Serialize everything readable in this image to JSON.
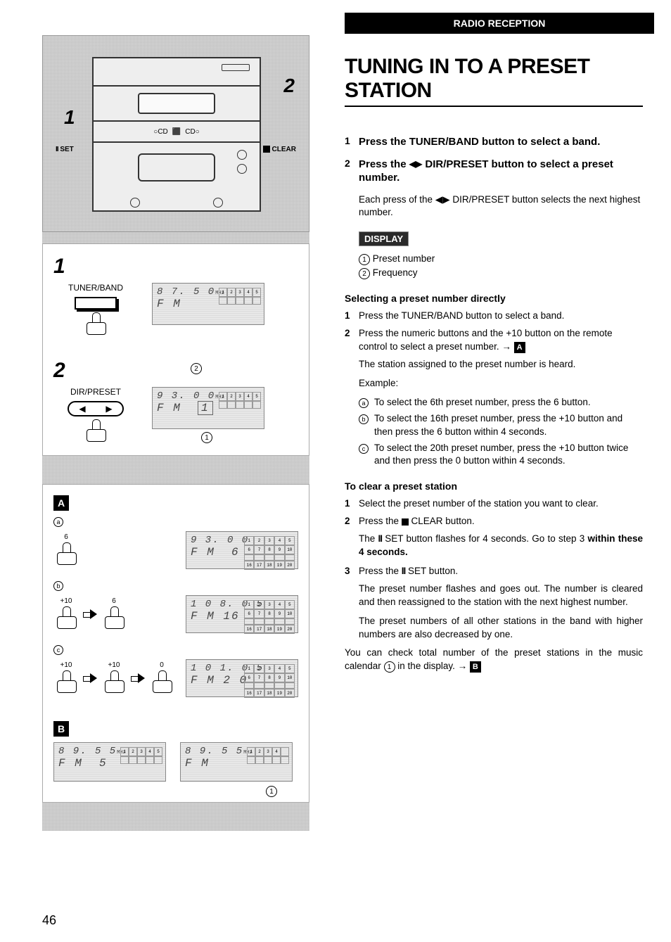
{
  "header": "RADIO RECEPTION",
  "title": "TUNING IN TO A PRESET STATION",
  "page_number": "46",
  "device": {
    "callout1": "1",
    "callout2": "2",
    "set_label": "SET",
    "clear_label": "CLEAR"
  },
  "panel1": {
    "step": "1",
    "button_label": "TUNER/BAND",
    "lcd_freq": "8 7. 5 0",
    "lcd_mhz": "MHz",
    "lcd_band": "F M"
  },
  "panel2": {
    "step": "2",
    "button_label": "DIR/PRESET",
    "callout_top": "2",
    "callout_bottom": "1",
    "lcd_freq": "9 3. 0 0",
    "lcd_mhz": "MHz",
    "lcd_band": "F M",
    "lcd_preset": "1"
  },
  "panelA": {
    "letter": "A",
    "rows": {
      "a": {
        "tag": "a",
        "presses": [
          "6"
        ],
        "freq": "9 3. 0 0",
        "band": "F M",
        "preset": "6"
      },
      "b": {
        "tag": "b",
        "presses": [
          "+10",
          "6"
        ],
        "freq": "1 0 8. 0 5",
        "band": "F M",
        "preset": "16"
      },
      "c": {
        "tag": "c",
        "presses": [
          "+10",
          "+10",
          "0"
        ],
        "freq": "1 0 1. 0 5",
        "band": "F M 2 0"
      }
    }
  },
  "panelB": {
    "letter": "B",
    "callout": "1",
    "left": {
      "freq": "8 9. 5 5",
      "mhz": "MHz",
      "band": "F M",
      "preset": "5",
      "grid_n": "5"
    },
    "right": {
      "freq": "8 9. 5 5",
      "mhz": "MHz",
      "band": "F M",
      "grid_n": "4"
    }
  },
  "instructions": {
    "step1": "Press the TUNER/BAND button to select a band.",
    "step2_a": "Press the ",
    "step2_b": " DIR/PRESET button to select a preset number.",
    "sub2": "Each press of the ◀▶ DIR/PRESET button selects the next highest number.",
    "display_label": "DISPLAY",
    "d1": "Preset number",
    "d2": "Frequency"
  },
  "selecting": {
    "heading": "Selecting a preset number directly",
    "s1": "Press the TUNER/BAND button to select a band.",
    "s2": "Press the numeric buttons and the +10 button on the remote control to select a preset number. → ",
    "s2_ref": "A",
    "p1": "The station assigned to the preset number is heard.",
    "p2": "Example:",
    "ea": "To select the 6th preset number, press the 6 button.",
    "eb": "To select the 16th preset number, press the +10 button and then press the 6 button within 4 seconds.",
    "ec": "To select the 20th preset number, press the +10 button twice and then press the 0 button within 4 seconds."
  },
  "clearing": {
    "heading": "To clear a preset station",
    "c1": "Select the preset number of the station you want to clear.",
    "c2a": "Press the ",
    "c2b": " CLEAR button.",
    "c2p_a": "The ",
    "c2p_b": " SET button flashes for 4 seconds.  Go to step 3 ",
    "c2p_bold": "within these 4 seconds.",
    "c3a": "Press the ",
    "c3b": " SET button.",
    "c3p1": "The preset number flashes and goes out.  The number is cleared and then reassigned to the station with the next highest number.",
    "c3p2": "The preset numbers of all other stations in the band with higher numbers are also decreased by one."
  },
  "footer": {
    "text_a": "You can check total number of the preset stations in the music calendar ",
    "text_b": " in the display.  → ",
    "ref": "B"
  }
}
